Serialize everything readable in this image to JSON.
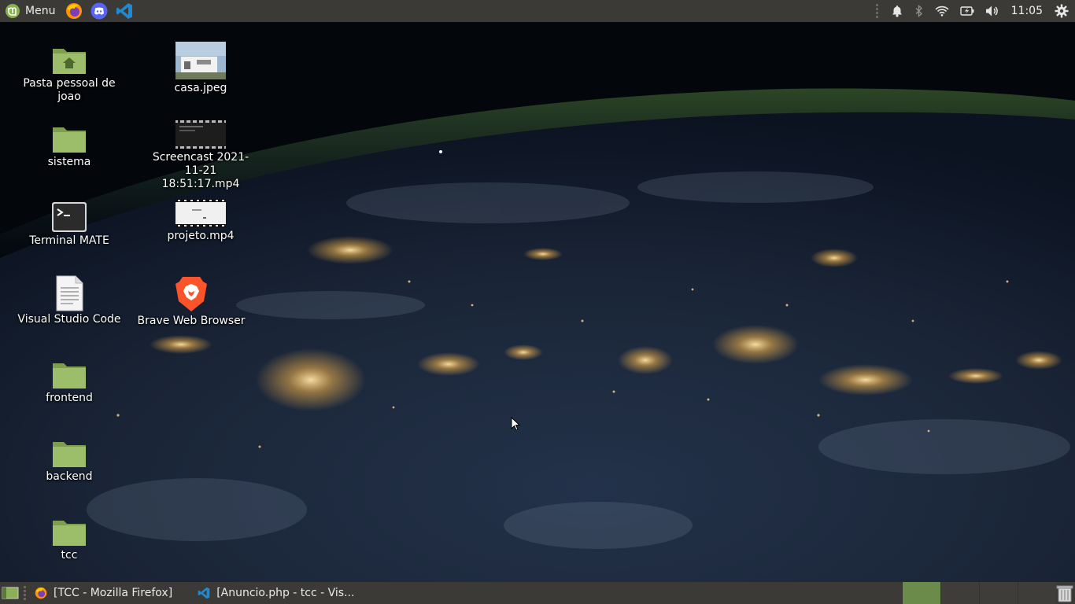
{
  "top_panel": {
    "menu_label": "Menu",
    "menu_icon": "mint-logo-icon",
    "launchers": [
      {
        "name": "firefox-icon"
      },
      {
        "name": "discord-icon"
      },
      {
        "name": "vscode-icon"
      }
    ],
    "tray": [
      "notification-bell-icon",
      "bluetooth-icon",
      "wifi-icon",
      "battery-icon",
      "volume-icon"
    ],
    "clock": "11:05",
    "settings_icon": "gear-icon"
  },
  "desktop": {
    "icons": [
      {
        "label": "Pasta pessoal de joao",
        "icon": "home-folder-icon"
      },
      {
        "label": "sistema",
        "icon": "folder-icon"
      },
      {
        "label": "Terminal MATE",
        "icon": "terminal-icon"
      },
      {
        "label": "Visual Studio Code",
        "icon": "text-file-icon"
      },
      {
        "label": "frontend",
        "icon": "folder-icon"
      },
      {
        "label": "backend",
        "icon": "folder-icon"
      },
      {
        "label": "tcc",
        "icon": "folder-icon"
      },
      {
        "label": "casa.jpeg",
        "icon": "image-thumbnail-icon"
      },
      {
        "label": "Screencast 2021-11-21 18:51:17.mp4",
        "icon": "video-thumbnail-icon"
      },
      {
        "label": "projeto.mp4",
        "icon": "video-thumbnail-icon"
      },
      {
        "label": "Brave Web Browser",
        "icon": "brave-icon"
      }
    ]
  },
  "bottom_panel": {
    "show_desktop_icon": "show-desktop-icon",
    "tasks": [
      {
        "label": "[TCC - Mozilla Firefox]",
        "icon": "firefox-icon"
      },
      {
        "label": "[Anuncio.php - tcc - Vis...",
        "icon": "vscode-icon"
      }
    ],
    "workspace_count": 4,
    "active_workspace": 1,
    "trash_icon": "trash-icon"
  },
  "colors": {
    "panel": "#3b3a37",
    "folder_green": "#8fb05d",
    "workspace_active": "#6b8b4a"
  }
}
